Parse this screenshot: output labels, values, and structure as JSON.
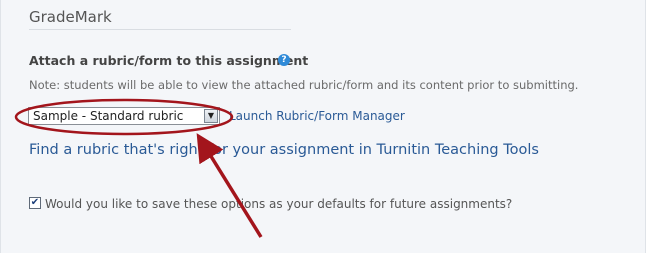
{
  "section": {
    "title": "GradeMark"
  },
  "rubric": {
    "heading": "Attach a rubric/form to this assignment",
    "help_icon": "?",
    "note": "Note: students will be able to view the attached rubric/form and its content prior to submitting.",
    "selected_value": "Sample - Standard rubric",
    "dropdown_arrow": "▼",
    "launch_link": "Launch Rubric/Form Manager",
    "find_link": "Find a rubric that's right for your assignment in Turnitin Teaching Tools"
  },
  "defaults": {
    "checked": true,
    "check_mark": "✔",
    "label": "Would you like to save these options as your defaults for future assignments?"
  },
  "annotation": {
    "color": "#a3151c"
  }
}
